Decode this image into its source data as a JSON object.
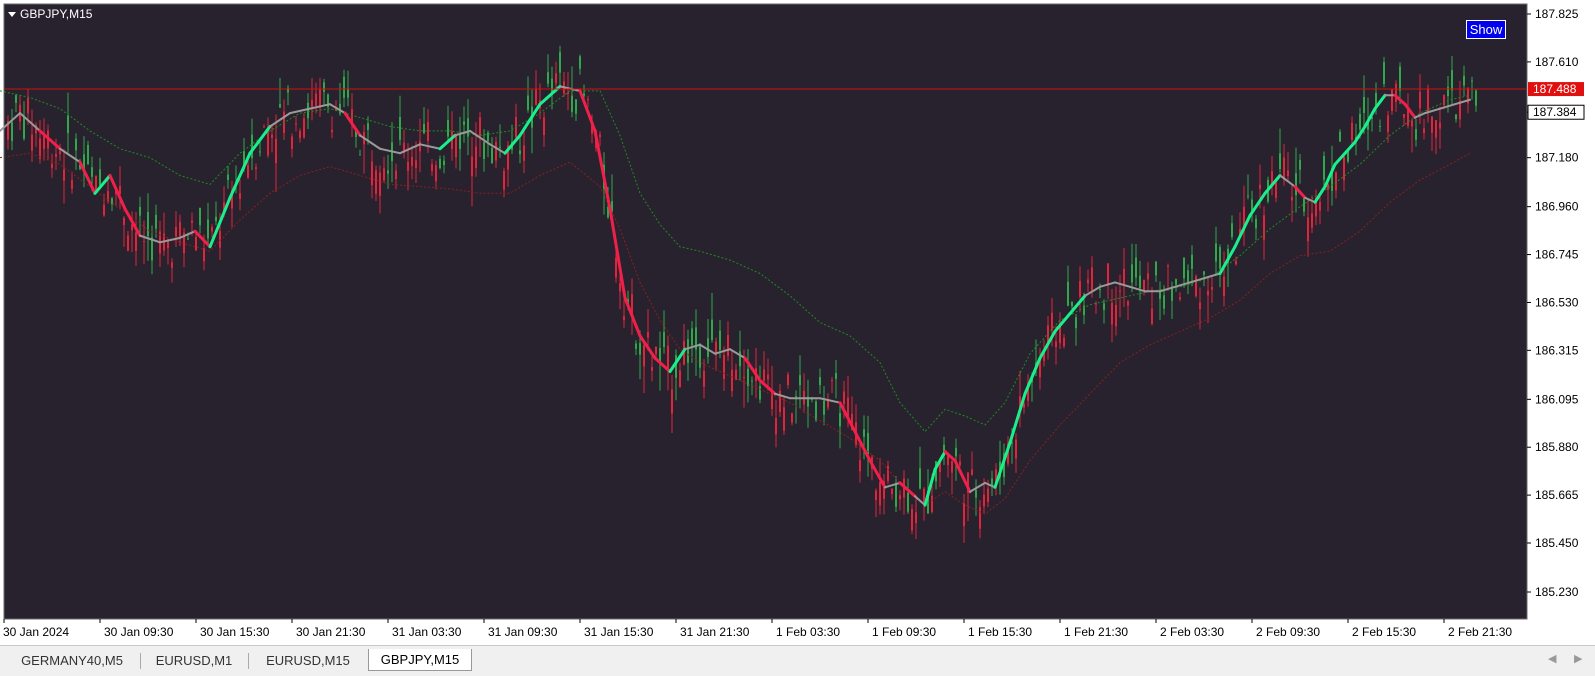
{
  "chart_data": {
    "type": "candlestick",
    "symbol": "GBPJPY,M15",
    "y_ticks": [
      "187.825",
      "187.610",
      "187.384",
      "187.180",
      "186.960",
      "186.745",
      "186.530",
      "186.315",
      "186.095",
      "185.880",
      "185.665",
      "185.450",
      "185.230"
    ],
    "ylim": [
      185.2,
      187.85
    ],
    "x_ticks": [
      "30 Jan 2024",
      "30 Jan 09:30",
      "30 Jan 15:30",
      "30 Jan 21:30",
      "31 Jan 03:30",
      "31 Jan 09:30",
      "31 Jan 15:30",
      "31 Jan 21:30",
      "1 Feb 03:30",
      "1 Feb 09:30",
      "1 Feb 15:30",
      "1 Feb 21:30",
      "2 Feb 03:30",
      "2 Feb 09:30",
      "2 Feb 15:30",
      "2 Feb 21:30"
    ],
    "current_price": "187.384",
    "ask_line": "187.488",
    "ask_line_value": 187.488,
    "colors": {
      "background": "#27222e",
      "bull": "#2ea84a",
      "bear": "#e0243c",
      "ma_up": "#19f08c",
      "ma_down": "#f0204a",
      "ma_flat": "#9a9a9a",
      "band_upper": "#1f8c1f",
      "band_lower": "#8c1f1f",
      "ask_line": "#d01010"
    },
    "ma_path": [
      [
        0,
        187.3
      ],
      [
        20,
        187.38
      ],
      [
        40,
        187.3
      ],
      [
        60,
        187.22
      ],
      [
        80,
        187.16
      ],
      [
        95,
        187.02
      ],
      [
        110,
        187.1
      ],
      [
        125,
        186.95
      ],
      [
        140,
        186.83
      ],
      [
        160,
        186.8
      ],
      [
        180,
        186.82
      ],
      [
        195,
        186.85
      ],
      [
        210,
        186.78
      ],
      [
        230,
        187.0
      ],
      [
        250,
        187.2
      ],
      [
        270,
        187.32
      ],
      [
        290,
        187.38
      ],
      [
        310,
        187.4
      ],
      [
        330,
        187.42
      ],
      [
        345,
        187.38
      ],
      [
        360,
        187.28
      ],
      [
        380,
        187.22
      ],
      [
        400,
        187.2
      ],
      [
        420,
        187.24
      ],
      [
        440,
        187.22
      ],
      [
        455,
        187.28
      ],
      [
        470,
        187.3
      ],
      [
        490,
        187.24
      ],
      [
        505,
        187.2
      ],
      [
        520,
        187.28
      ],
      [
        540,
        187.42
      ],
      [
        560,
        187.5
      ],
      [
        580,
        187.48
      ],
      [
        595,
        187.3
      ],
      [
        610,
        186.95
      ],
      [
        625,
        186.55
      ],
      [
        640,
        186.38
      ],
      [
        655,
        186.28
      ],
      [
        670,
        186.22
      ],
      [
        685,
        186.32
      ],
      [
        700,
        186.34
      ],
      [
        715,
        186.3
      ],
      [
        730,
        186.32
      ],
      [
        745,
        186.28
      ],
      [
        760,
        186.18
      ],
      [
        775,
        186.12
      ],
      [
        790,
        186.1
      ],
      [
        805,
        186.1
      ],
      [
        820,
        186.1
      ],
      [
        840,
        186.08
      ],
      [
        855,
        185.95
      ],
      [
        870,
        185.82
      ],
      [
        885,
        185.7
      ],
      [
        900,
        185.72
      ],
      [
        915,
        185.66
      ],
      [
        925,
        185.62
      ],
      [
        935,
        185.78
      ],
      [
        945,
        185.86
      ],
      [
        955,
        185.82
      ],
      [
        970,
        185.68
      ],
      [
        985,
        185.72
      ],
      [
        995,
        185.7
      ],
      [
        1010,
        185.9
      ],
      [
        1025,
        186.12
      ],
      [
        1040,
        186.28
      ],
      [
        1055,
        186.4
      ],
      [
        1070,
        186.48
      ],
      [
        1085,
        186.56
      ],
      [
        1100,
        186.6
      ],
      [
        1115,
        186.62
      ],
      [
        1130,
        186.6
      ],
      [
        1145,
        186.58
      ],
      [
        1160,
        186.58
      ],
      [
        1175,
        186.6
      ],
      [
        1190,
        186.62
      ],
      [
        1205,
        186.64
      ],
      [
        1220,
        186.66
      ],
      [
        1235,
        186.78
      ],
      [
        1250,
        186.92
      ],
      [
        1265,
        187.02
      ],
      [
        1280,
        187.1
      ],
      [
        1295,
        187.05
      ],
      [
        1305,
        187.0
      ],
      [
        1315,
        186.98
      ],
      [
        1325,
        187.05
      ],
      [
        1335,
        187.15
      ],
      [
        1345,
        187.2
      ],
      [
        1355,
        187.25
      ],
      [
        1365,
        187.32
      ],
      [
        1375,
        187.4
      ],
      [
        1385,
        187.46
      ],
      [
        1395,
        187.46
      ],
      [
        1405,
        187.42
      ],
      [
        1415,
        187.36
      ],
      [
        1425,
        187.38
      ],
      [
        1440,
        187.4
      ],
      [
        1455,
        187.42
      ],
      [
        1470,
        187.44
      ]
    ],
    "band_upper": [
      [
        0,
        187.48
      ],
      [
        30,
        187.45
      ],
      [
        60,
        187.4
      ],
      [
        90,
        187.3
      ],
      [
        120,
        187.22
      ],
      [
        150,
        187.18
      ],
      [
        180,
        187.1
      ],
      [
        210,
        187.06
      ],
      [
        240,
        187.2
      ],
      [
        270,
        187.3
      ],
      [
        300,
        187.38
      ],
      [
        330,
        187.4
      ],
      [
        360,
        187.36
      ],
      [
        390,
        187.32
      ],
      [
        420,
        187.3
      ],
      [
        450,
        187.3
      ],
      [
        480,
        187.28
      ],
      [
        510,
        187.3
      ],
      [
        540,
        187.38
      ],
      [
        570,
        187.48
      ],
      [
        600,
        187.48
      ],
      [
        620,
        187.28
      ],
      [
        640,
        187.02
      ],
      [
        660,
        186.88
      ],
      [
        680,
        186.78
      ],
      [
        700,
        186.76
      ],
      [
        730,
        186.72
      ],
      [
        760,
        186.66
      ],
      [
        790,
        186.56
      ],
      [
        820,
        186.44
      ],
      [
        850,
        186.38
      ],
      [
        880,
        186.26
      ],
      [
        900,
        186.08
      ],
      [
        925,
        185.95
      ],
      [
        945,
        186.05
      ],
      [
        965,
        186.02
      ],
      [
        985,
        185.98
      ],
      [
        1005,
        186.08
      ],
      [
        1030,
        186.3
      ],
      [
        1060,
        186.45
      ],
      [
        1090,
        186.52
      ],
      [
        1120,
        186.55
      ],
      [
        1150,
        186.58
      ],
      [
        1180,
        186.6
      ],
      [
        1210,
        186.64
      ],
      [
        1240,
        186.74
      ],
      [
        1270,
        186.86
      ],
      [
        1300,
        186.96
      ],
      [
        1330,
        187.05
      ],
      [
        1360,
        187.15
      ],
      [
        1390,
        187.28
      ],
      [
        1420,
        187.38
      ],
      [
        1450,
        187.44
      ],
      [
        1470,
        187.46
      ]
    ],
    "band_lower": [
      [
        0,
        187.18
      ],
      [
        30,
        187.2
      ],
      [
        60,
        187.15
      ],
      [
        90,
        187.05
      ],
      [
        120,
        186.95
      ],
      [
        150,
        186.85
      ],
      [
        180,
        186.8
      ],
      [
        210,
        186.76
      ],
      [
        240,
        186.9
      ],
      [
        270,
        187.02
      ],
      [
        300,
        187.1
      ],
      [
        330,
        187.14
      ],
      [
        360,
        187.1
      ],
      [
        390,
        187.06
      ],
      [
        420,
        187.05
      ],
      [
        450,
        187.04
      ],
      [
        480,
        187.02
      ],
      [
        510,
        187.02
      ],
      [
        540,
        187.1
      ],
      [
        570,
        187.16
      ],
      [
        600,
        187.05
      ],
      [
        620,
        186.86
      ],
      [
        640,
        186.62
      ],
      [
        660,
        186.45
      ],
      [
        680,
        186.32
      ],
      [
        700,
        186.26
      ],
      [
        730,
        186.2
      ],
      [
        760,
        186.14
      ],
      [
        790,
        186.08
      ],
      [
        820,
        186.0
      ],
      [
        850,
        185.92
      ],
      [
        880,
        185.82
      ],
      [
        900,
        185.72
      ],
      [
        925,
        185.62
      ],
      [
        945,
        185.68
      ],
      [
        965,
        185.62
      ],
      [
        985,
        185.58
      ],
      [
        1005,
        185.65
      ],
      [
        1030,
        185.82
      ],
      [
        1060,
        185.98
      ],
      [
        1090,
        186.12
      ],
      [
        1120,
        186.26
      ],
      [
        1150,
        186.34
      ],
      [
        1180,
        186.4
      ],
      [
        1210,
        186.46
      ],
      [
        1240,
        186.54
      ],
      [
        1270,
        186.66
      ],
      [
        1300,
        186.74
      ],
      [
        1330,
        186.76
      ],
      [
        1360,
        186.85
      ],
      [
        1390,
        186.98
      ],
      [
        1420,
        187.08
      ],
      [
        1450,
        187.15
      ],
      [
        1470,
        187.2
      ]
    ]
  },
  "show_button": {
    "label": "Show"
  },
  "tabs": [
    {
      "label": "GERMANY40,M5",
      "active": false
    },
    {
      "label": "EURUSD,M1",
      "active": false
    },
    {
      "label": "EURUSD,M15",
      "active": false
    },
    {
      "label": "GBPJPY,M15",
      "active": true
    }
  ],
  "scroll": {
    "left": "◀",
    "right": "▶"
  }
}
